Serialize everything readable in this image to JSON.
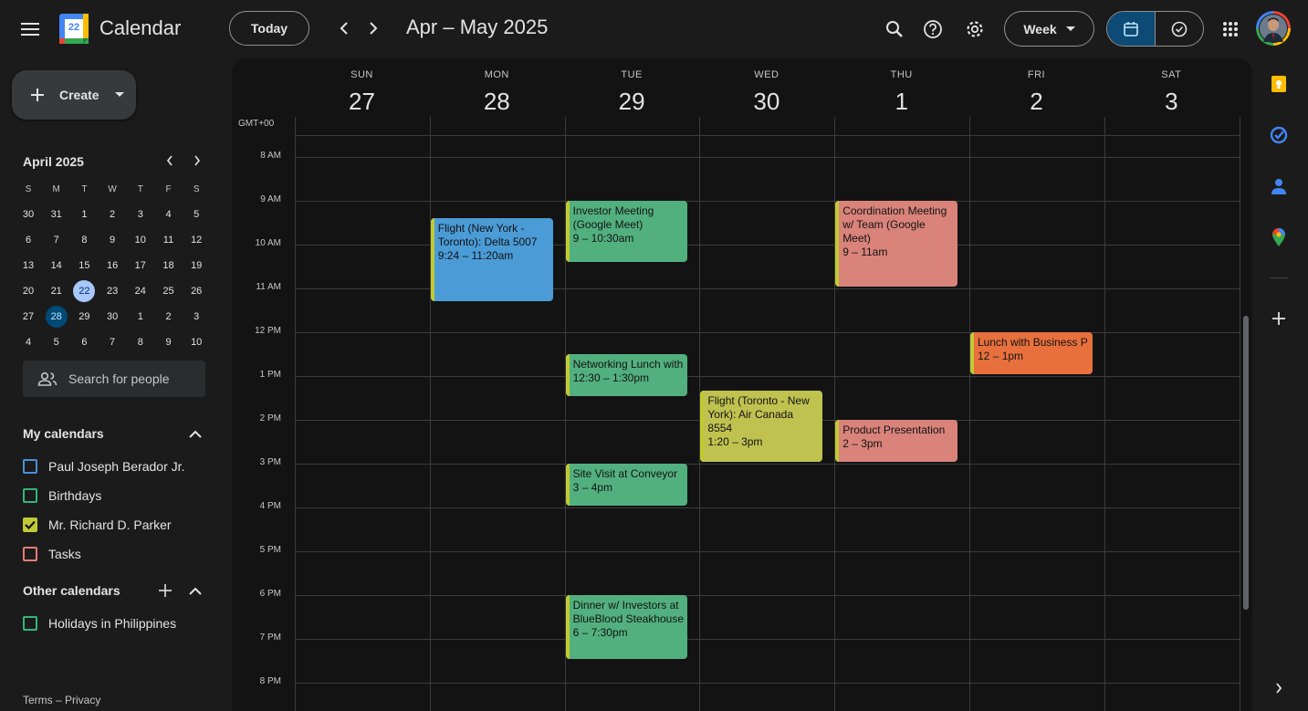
{
  "header": {
    "app_title": "Calendar",
    "logo_day": "22",
    "today_label": "Today",
    "date_range": "Apr – May 2025",
    "view_label": "Week"
  },
  "sidebar": {
    "create_label": "Create",
    "mini_calendar": {
      "month_title": "April 2025",
      "weekday_headers": [
        "S",
        "M",
        "T",
        "W",
        "T",
        "F",
        "S"
      ],
      "weeks": [
        [
          "30",
          "31",
          "1",
          "2",
          "3",
          "4",
          "5"
        ],
        [
          "6",
          "7",
          "8",
          "9",
          "10",
          "11",
          "12"
        ],
        [
          "13",
          "14",
          "15",
          "16",
          "17",
          "18",
          "19"
        ],
        [
          "20",
          "21",
          "22",
          "23",
          "24",
          "25",
          "26"
        ],
        [
          "27",
          "28",
          "29",
          "30",
          "1",
          "2",
          "3"
        ],
        [
          "4",
          "5",
          "6",
          "7",
          "8",
          "9",
          "10"
        ]
      ],
      "today": "22",
      "selected": "28"
    },
    "people_search_placeholder": "Search for people",
    "my_calendars_title": "My calendars",
    "my_calendars": [
      {
        "name": "Paul Joseph Berador Jr.",
        "color": "#4a90d9",
        "checked": false
      },
      {
        "name": "Birthdays",
        "color": "#33b679",
        "checked": false
      },
      {
        "name": "Mr. Richard D. Parker",
        "color": "#c0ca33",
        "checked": true
      },
      {
        "name": "Tasks",
        "color": "#e67c73",
        "checked": false
      }
    ],
    "other_calendars_title": "Other calendars",
    "other_calendars": [
      {
        "name": "Holidays in Philippines",
        "color": "#33b679",
        "checked": false
      }
    ],
    "footer": "Terms – Privacy"
  },
  "week": {
    "timezone": "GMT+00",
    "days": [
      {
        "dow": "SUN",
        "num": "27"
      },
      {
        "dow": "MON",
        "num": "28"
      },
      {
        "dow": "TUE",
        "num": "29"
      },
      {
        "dow": "WED",
        "num": "30"
      },
      {
        "dow": "THU",
        "num": "1"
      },
      {
        "dow": "FRI",
        "num": "2"
      },
      {
        "dow": "SAT",
        "num": "3"
      }
    ],
    "hours": [
      "8 AM",
      "9 AM",
      "10 AM",
      "11 AM",
      "12 PM",
      "1 PM",
      "2 PM",
      "3 PM",
      "4 PM",
      "5 PM",
      "6 PM",
      "7 PM",
      "8 PM"
    ],
    "events": [
      {
        "id": "flight-ny-toronto",
        "title": "Flight (New York - Toronto): Delta 5007",
        "time": "9:24 – 11:20am",
        "day": 1,
        "start": 9.4,
        "end": 11.3,
        "color": "#4a9bd6",
        "bar": "#c0ca33"
      },
      {
        "id": "investor-meeting",
        "title": "Investor Meeting (Google Meet)",
        "time": "9 – 10:30am",
        "day": 2,
        "start": 9.0,
        "end": 10.4,
        "color": "#52b07e",
        "bar": "#c0ca33"
      },
      {
        "id": "networking-lunch",
        "title": "Networking Lunch with",
        "time": "12:30 – 1:30pm",
        "day": 2,
        "start": 12.5,
        "end": 13.45,
        "color": "#52b07e",
        "bar": "#c0ca33"
      },
      {
        "id": "site-visit",
        "title": "Site Visit at Conveyor",
        "time": "3 – 4pm",
        "day": 2,
        "start": 15.0,
        "end": 15.95,
        "color": "#52b07e",
        "bar": "#c0ca33"
      },
      {
        "id": "dinner-investors",
        "title": "Dinner w/ Investors at BlueBlood Steakhouse",
        "time": "6 – 7:30pm",
        "day": 2,
        "start": 18.0,
        "end": 19.45,
        "color": "#52b07e",
        "bar": "#c0ca33"
      },
      {
        "id": "flight-toronto-ny",
        "title": "Flight (Toronto - New York): Air Canada 8554",
        "time": "1:20 – 3pm",
        "day": 3,
        "start": 13.33,
        "end": 14.95,
        "color": "#bfc24f",
        "bar": "#c0ca33"
      },
      {
        "id": "coordination-meeting",
        "title": "Coordination Meeting w/ Team (Google Meet)",
        "time": "9 – 11am",
        "day": 4,
        "start": 9.0,
        "end": 10.95,
        "color": "#d9837a",
        "bar": "#c0ca33"
      },
      {
        "id": "product-presentation",
        "title": "Product Presentation",
        "time": "2 – 3pm",
        "day": 4,
        "start": 14.0,
        "end": 14.95,
        "color": "#d9837a",
        "bar": "#c0ca33"
      },
      {
        "id": "lunch-business",
        "title": "Lunch with Business P",
        "time": "12 – 1pm",
        "day": 5,
        "start": 12.0,
        "end": 12.95,
        "color": "#e8703c",
        "bar": "#c0ca33"
      }
    ]
  },
  "colors": {
    "background": "#1b1b1b",
    "panel": "#131314",
    "accent": "#0d4a75"
  }
}
